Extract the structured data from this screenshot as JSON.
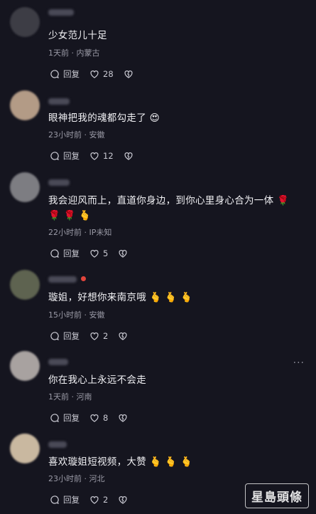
{
  "comments": [
    {
      "text": "少女范儿十足",
      "meta": "1天前 · 内蒙古",
      "reply": "回复",
      "likes": "28"
    },
    {
      "text": "眼神把我的魂都勾走了 😍",
      "meta": "23小时前 · 安徽",
      "reply": "回复",
      "likes": "12"
    },
    {
      "text": "我会迎风而上，直道你身边，到你心里身心合为一体 🌹 🌹 🌹 🫰",
      "meta": "22小时前 · IP未知",
      "reply": "回复",
      "likes": "5"
    },
    {
      "text": "璇姐，好想你来南京哦 🫰 🫰 🫰",
      "meta": "15小时前 · 安徽",
      "reply": "回复",
      "likes": "2"
    },
    {
      "text": "你在我心上永远不会走",
      "meta": "1天前 · 河南",
      "reply": "回复",
      "likes": "8"
    },
    {
      "text": "喜欢璇姐短视频，大赞 🫰 🫰 🫰",
      "meta": "23小时前 · 河北",
      "reply": "回复",
      "likes": "2"
    }
  ],
  "more_menu": "···",
  "watermark": "星島頭條",
  "colors": {
    "background": "#15151f",
    "meta": "#9a9aa6",
    "text": "#f1f1f4"
  }
}
